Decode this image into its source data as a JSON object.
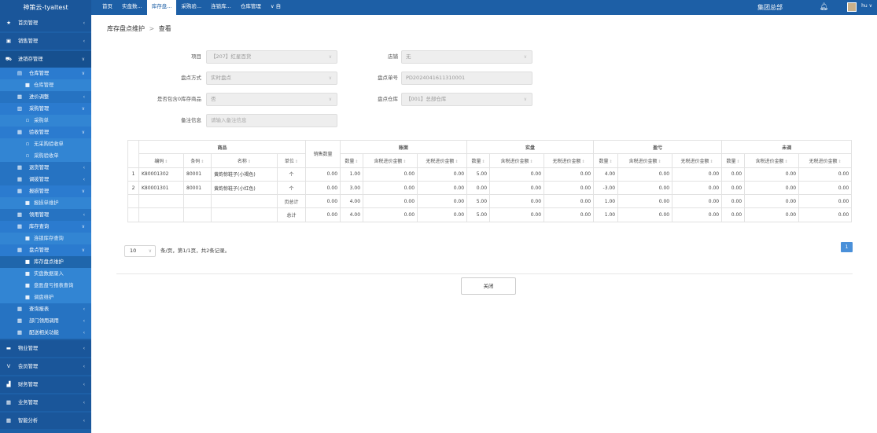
{
  "app": {
    "brand": "神策云-tyaltest"
  },
  "topnav": {
    "tabs": [
      {
        "label": "首页",
        "active": false
      },
      {
        "label": "实盘数...",
        "active": false
      },
      {
        "label": "库存盘...",
        "active": true
      },
      {
        "label": "采购验...",
        "active": false
      },
      {
        "label": "连锁库...",
        "active": false
      },
      {
        "label": "仓库管理",
        "active": false
      }
    ],
    "more_label": "∨ 自",
    "org": "集团总部",
    "user": "hu"
  },
  "sidebar": {
    "items": [
      {
        "label": "首页管理",
        "icon": "star-icon",
        "glyph": "★",
        "level": 1
      },
      {
        "label": "销售管理",
        "icon": "monitor-icon",
        "glyph": "▣",
        "level": 1
      },
      {
        "label": "进销存管理",
        "icon": "truck-icon",
        "glyph": "⛟",
        "level": 1,
        "open": true
      },
      {
        "label": "仓库管理",
        "icon": "warehouse-icon",
        "glyph": "▤",
        "level": 2,
        "open": true
      },
      {
        "label": "仓库管理",
        "icon": "square-icon",
        "glyph": "■",
        "level": 3
      },
      {
        "label": "进价调整",
        "icon": "grid-icon",
        "glyph": "▦",
        "level": 2
      },
      {
        "label": "采购管理",
        "icon": "doc-icon",
        "glyph": "▥",
        "level": 2,
        "open": true
      },
      {
        "label": "采购单",
        "icon": "file-icon",
        "glyph": "▫",
        "level": 3
      },
      {
        "label": "验收管理",
        "icon": "grid-icon",
        "glyph": "▦",
        "level": 2,
        "open": true
      },
      {
        "label": "无采购验收单",
        "icon": "file-icon",
        "glyph": "▫",
        "level": 3
      },
      {
        "label": "采购验收单",
        "icon": "file-icon",
        "glyph": "▫",
        "level": 3
      },
      {
        "label": "退货管理",
        "icon": "grid-icon",
        "glyph": "▦",
        "level": 2
      },
      {
        "label": "调拨管理",
        "icon": "grid-icon",
        "glyph": "▦",
        "level": 2
      },
      {
        "label": "报损管理",
        "icon": "grid-icon",
        "glyph": "▦",
        "level": 2,
        "open": true
      },
      {
        "label": "报损单维护",
        "icon": "square-icon",
        "glyph": "■",
        "level": 3
      },
      {
        "label": "领用管理",
        "icon": "grid-icon",
        "glyph": "▦",
        "level": 2
      },
      {
        "label": "库存查询",
        "icon": "grid-icon",
        "glyph": "▦",
        "level": 2,
        "open": true
      },
      {
        "label": "连锁库存查询",
        "icon": "square-icon",
        "glyph": "■",
        "level": 3
      },
      {
        "label": "盘点管理",
        "icon": "grid-icon",
        "glyph": "▦",
        "level": 2,
        "open": true
      },
      {
        "label": "库存盘点维护",
        "icon": "square-icon",
        "glyph": "■",
        "level": 3,
        "active": true
      },
      {
        "label": "实盘数据录入",
        "icon": "square-icon",
        "glyph": "■",
        "level": 3
      },
      {
        "label": "盘盈盘亏报表查询",
        "icon": "square-icon",
        "glyph": "■",
        "level": 3
      },
      {
        "label": "调盘维护",
        "icon": "square-icon",
        "glyph": "■",
        "level": 3
      },
      {
        "label": "查询报表",
        "icon": "grid-icon",
        "glyph": "▦",
        "level": 2
      },
      {
        "label": "部门领用调用",
        "icon": "grid-icon",
        "glyph": "▦",
        "level": 2
      },
      {
        "label": "配送相关功能",
        "icon": "grid-icon",
        "glyph": "▦",
        "level": 2
      },
      {
        "label": "物业管理",
        "icon": "building-icon",
        "glyph": "▬",
        "level": 1
      },
      {
        "label": "会员管理",
        "icon": "vip-icon",
        "glyph": "V",
        "level": 1
      },
      {
        "label": "财务管理",
        "icon": "bar-chart-icon",
        "glyph": "▟",
        "level": 1
      },
      {
        "label": "业务管理",
        "icon": "grid-icon",
        "glyph": "▦",
        "level": 1
      },
      {
        "label": "智能分析",
        "icon": "grid-icon",
        "glyph": "▦",
        "level": 1
      }
    ]
  },
  "breadcrumb": {
    "parent": "库存盘点维护",
    "sep": ">",
    "current": "查看"
  },
  "form": {
    "project": {
      "label": "项目",
      "value": "【207】红星百货"
    },
    "shop": {
      "label": "店铺",
      "value": "无"
    },
    "method": {
      "label": "盘点方式",
      "value": "实时盘点"
    },
    "doc_no": {
      "label": "盘点单号",
      "value": "PD2024041611310001"
    },
    "include_zero": {
      "label": "是否包含0库存商品",
      "value": "否"
    },
    "warehouse": {
      "label": "盘点仓库",
      "value": "【001】总部仓库"
    },
    "remark": {
      "label": "备注信息",
      "placeholder": "请输入备注信息"
    }
  },
  "table": {
    "groups": {
      "goods": "商品",
      "sales_qty": "销售数量",
      "book": "账面",
      "actual": "实盘",
      "diff": "盈亏",
      "unadjusted": "未调"
    },
    "sub": {
      "code": "编码",
      "barcode": "条码",
      "name": "名称",
      "unit": "单位",
      "qty": "数量",
      "tax_amt": "含税进价金额",
      "notax_amt": "无税进价金额"
    },
    "rows": [
      {
        "idx": "1",
        "code": "K80001302",
        "barcode": "80001",
        "name": "黄韵惊鞋子(小褐色)",
        "unit": "个",
        "sales": "0.00",
        "v": [
          "1.00",
          "0.00",
          "0.00",
          "5.00",
          "0.00",
          "0.00",
          "4.00",
          "0.00",
          "0.00",
          "0.00",
          "0.00",
          "0.00"
        ]
      },
      {
        "idx": "2",
        "code": "K80001301",
        "barcode": "80001",
        "name": "黄韵惊鞋子(小红色)",
        "unit": "个",
        "sales": "0.00",
        "v": [
          "3.00",
          "0.00",
          "0.00",
          "0.00",
          "0.00",
          "0.00",
          "-3.00",
          "0.00",
          "0.00",
          "0.00",
          "0.00",
          "0.00"
        ]
      },
      {
        "idx": "",
        "code": "",
        "barcode": "",
        "name": "",
        "unit": "页总计",
        "sales": "0.00",
        "v": [
          "4.00",
          "0.00",
          "0.00",
          "5.00",
          "0.00",
          "0.00",
          "1.00",
          "0.00",
          "0.00",
          "0.00",
          "0.00",
          "0.00"
        ]
      },
      {
        "idx": "",
        "code": "",
        "barcode": "",
        "name": "",
        "unit": "总计",
        "sales": "0.00",
        "v": [
          "4.00",
          "0.00",
          "0.00",
          "5.00",
          "0.00",
          "0.00",
          "1.00",
          "0.00",
          "0.00",
          "0.00",
          "0.00",
          "0.00"
        ]
      }
    ]
  },
  "pager": {
    "page_size": "10",
    "summary": "条/页，第1/1页，共2条记录。",
    "current_page": "1"
  },
  "actions": {
    "close_label": "关闭"
  }
}
